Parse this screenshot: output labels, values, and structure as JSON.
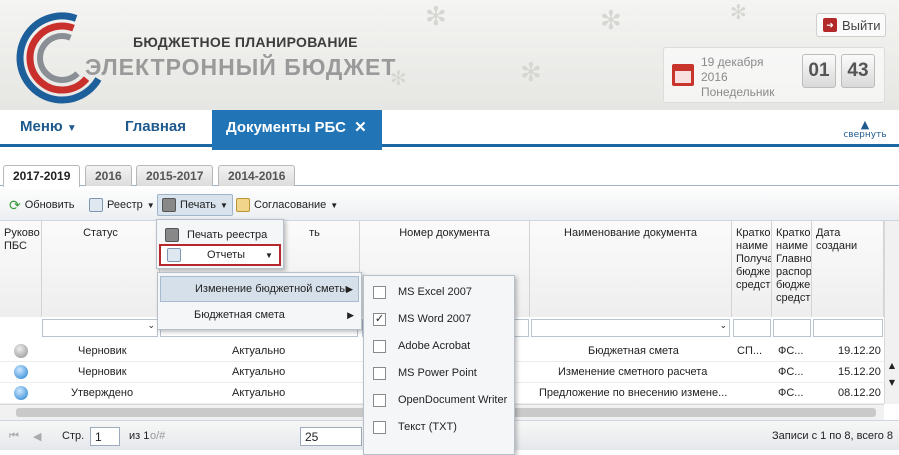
{
  "header": {
    "title_line1": "БЮДЖЕТНОЕ ПЛАНИРОВАНИЕ",
    "title_line2": "ЭЛЕКТРОННЫЙ БЮДЖЕТ",
    "exit_label": "Выйти",
    "date_line1": "19 декабря",
    "date_line2": "2016",
    "date_line3": "Понедельник",
    "hours": "01",
    "minutes": "43"
  },
  "nav": {
    "menu": "Меню",
    "home": "Главная",
    "active_tab": "Документы РБС",
    "active_close": "✕",
    "collapse": "свернуть"
  },
  "year_tabs": [
    "2017-2019",
    "2016",
    "2015-2017",
    "2014-2016"
  ],
  "toolbar": {
    "refresh": "Обновить",
    "registry": "Реестр",
    "print": "Печать",
    "approval": "Согласование"
  },
  "columns": {
    "c1": "Руково ПБС",
    "c2": "Статус",
    "c3": "ть",
    "c4": "Номер документа",
    "c5": "Наименование документа",
    "c6": "Кратко наиме Получа бюдже средст",
    "c7": "Кратко наиме Главно распор бюдже средст",
    "c8": "Дата создани"
  },
  "rows": [
    {
      "status": "Черновик",
      "state": "Актуально",
      "name": "Бюджетная смета",
      "short1": "СП...",
      "short2": "ФС...",
      "date": "19.12.20"
    },
    {
      "status": "Черновик",
      "state": "Актуально",
      "name": "Изменение сметного расчета",
      "short1": "",
      "short2": "ФС...",
      "date": "15.12.20"
    },
    {
      "status": "Утверждено",
      "state": "Актуально",
      "name": "Предложение по внесению измене...",
      "short1": "",
      "short2": "ФС...",
      "date": "08.12.20"
    }
  ],
  "paging": {
    "page_label": "Стр.",
    "page_value": "1",
    "of_label": "из 1",
    "filter_hint": "о/#",
    "page_size": "25",
    "records": "Записи с 1 по 8, всего 8"
  },
  "print_menu": {
    "registry_print": "Печать реестра",
    "reports": "Отчеты"
  },
  "reports_menu": {
    "item1": "Изменение бюджетной сметы",
    "item2": "Бюджетная смета"
  },
  "formats": [
    {
      "label": "MS Excel 2007",
      "checked": ""
    },
    {
      "label": "MS Word 2007",
      "checked": "✓"
    },
    {
      "label": "Adobe Acrobat",
      "checked": ""
    },
    {
      "label": "MS Power Point",
      "checked": ""
    },
    {
      "label": "OpenDocument Writer",
      "checked": ""
    },
    {
      "label": "Текст (TXT)",
      "checked": ""
    }
  ],
  "colors": {
    "accent": "#2175b6",
    "nav_text": "#1f5a8f",
    "highlight_border": "#b5272a",
    "status_grey": "#9a9a9a",
    "status_blue": "#1e7fd0"
  }
}
